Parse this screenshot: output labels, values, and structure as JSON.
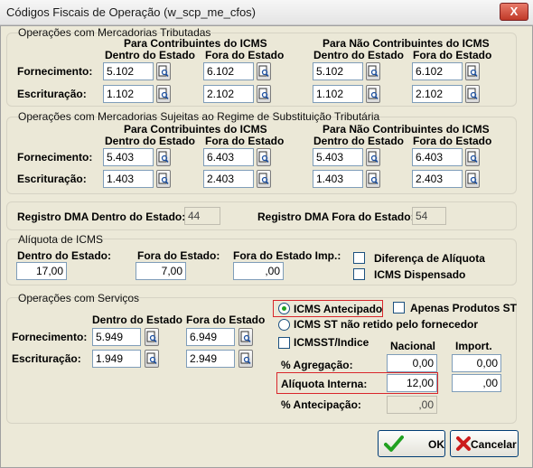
{
  "window": {
    "title": "Códigos Fiscais de Operação (w_scp_me_cfos)",
    "close_label": "X"
  },
  "trib": {
    "title": "Operações com Mercadorias Tributadas",
    "contrib_header": "Para Contribuintes do ICMS",
    "nao_contrib_header": "Para Não Contribuintes do ICMS",
    "dentro": "Dentro do Estado",
    "fora": "Fora do Estado",
    "row1_label": "Fornecimento:",
    "row2_label": "Escrituração:",
    "forn": [
      "5.102",
      "6.102",
      "5.102",
      "6.102"
    ],
    "escr": [
      "1.102",
      "2.102",
      "1.102",
      "2.102"
    ]
  },
  "st": {
    "title": "Operações com Mercadorias Sujeitas ao Regime de Substituição Tributária",
    "contrib_header": "Para Contribuintes do ICMS",
    "nao_contrib_header": "Para Não Contribuintes do ICMS",
    "dentro": "Dentro do Estado",
    "fora": "Fora do Estado",
    "row1_label": "Fornecimento:",
    "row2_label": "Escrituração:",
    "forn": [
      "5.403",
      "6.403",
      "5.403",
      "6.403"
    ],
    "escr": [
      "1.403",
      "2.403",
      "1.403",
      "2.403"
    ]
  },
  "dma": {
    "dentro_label": "Registro DMA Dentro do Estado:",
    "dentro_value": "44",
    "fora_label": "Registro DMA Fora do Estado:",
    "fora_value": "54"
  },
  "aliq": {
    "title": "Alíquota de ICMS",
    "dentro_label": "Dentro do Estado:",
    "dentro_value": "17,00",
    "fora_label": "Fora do Estado:",
    "fora_value": "7,00",
    "fora_imp_label": "Fora do Estado Imp.:",
    "fora_imp_value": ",00",
    "dif_label": "Diferença de Alíquota",
    "dispensado_label": "ICMS Dispensado"
  },
  "serv": {
    "title": "Operações com Serviços",
    "dentro": "Dentro do Estado",
    "fora": "Fora do Estado",
    "row1_label": "Fornecimento:",
    "row2_label": "Escrituração:",
    "forn": [
      "5.949",
      "6.949"
    ],
    "escr": [
      "1.949",
      "2.949"
    ]
  },
  "icms": {
    "antecipado_label": "ICMS Antecipado",
    "apenas_st_label": "Apenas Produtos ST",
    "st_nao_retido_label": "ICMS ST não retido pelo fornecedor",
    "icmsst_label": "ICMSST/Indice",
    "nacional_header": "Nacional",
    "import_header": "Import.",
    "agregacao_label": "% Agregação:",
    "agregacao_nac": "0,00",
    "agregacao_imp": "0,00",
    "aliq_interna_label": "Alíquota Interna:",
    "aliq_interna_nac": "12,00",
    "aliq_interna_imp": ",00",
    "antecipacao_label": "% Antecipação:",
    "antecipacao_nac": ",00"
  },
  "buttons": {
    "ok": "OK",
    "cancel": "Cancelar"
  },
  "colors": {
    "accent_red": "#d9262b",
    "check_green": "#21a121",
    "cancel_red": "#cc1a1a"
  }
}
